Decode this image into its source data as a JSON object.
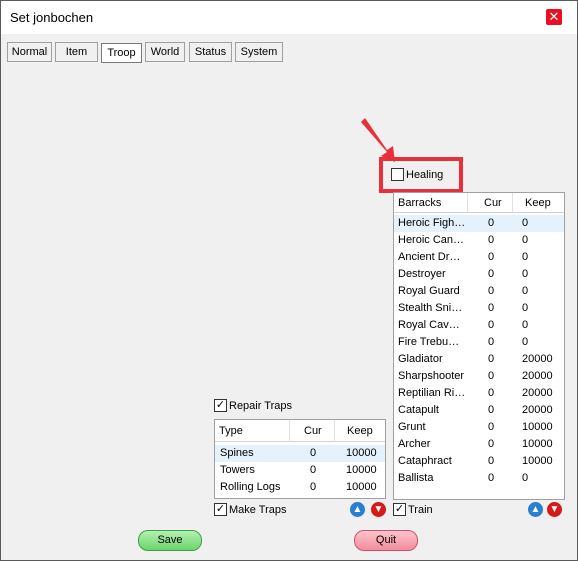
{
  "window": {
    "title": "Set jonbochen"
  },
  "tabs": [
    "Normal",
    "Item",
    "Troop",
    "World",
    "Status",
    "System"
  ],
  "active_tab": "Troop",
  "healing": {
    "label": "Healing",
    "checked": false
  },
  "barracks": {
    "headers": [
      "Barracks",
      "Cur",
      "Keep"
    ],
    "rows": [
      [
        "Heroic Figh…",
        "0",
        "0"
      ],
      [
        "Heroic Can…",
        "0",
        "0"
      ],
      [
        "Ancient Dr…",
        "0",
        "0"
      ],
      [
        "Destroyer",
        "0",
        "0"
      ],
      [
        "Royal Guard",
        "0",
        "0"
      ],
      [
        "Stealth Sni…",
        "0",
        "0"
      ],
      [
        "Royal Cav…",
        "0",
        "0"
      ],
      [
        "Fire Trebu…",
        "0",
        "0"
      ],
      [
        "Gladiator",
        "0",
        "20000"
      ],
      [
        "Sharpshooter",
        "0",
        "20000"
      ],
      [
        "Reptilian Ri…",
        "0",
        "20000"
      ],
      [
        "Catapult",
        "0",
        "20000"
      ],
      [
        "Grunt",
        "0",
        "10000"
      ],
      [
        "Archer",
        "0",
        "10000"
      ],
      [
        "Cataphract",
        "0",
        "10000"
      ],
      [
        "Ballista",
        "0",
        "0"
      ]
    ]
  },
  "train": {
    "label": "Train",
    "checked": true
  },
  "repair_traps": {
    "label": "Repair Traps",
    "checked": true
  },
  "traps": {
    "headers": [
      "Type",
      "Cur",
      "Keep"
    ],
    "rows": [
      [
        "Spines",
        "0",
        "10000"
      ],
      [
        "Towers",
        "0",
        "10000"
      ],
      [
        "Rolling Logs",
        "0",
        "10000"
      ]
    ]
  },
  "make_traps": {
    "label": "Make Traps",
    "checked": true
  },
  "buttons": {
    "save": "Save",
    "quit": "Quit"
  },
  "colors": {
    "highlight": "#e8303a",
    "up_arrow": "#2a7fd0",
    "down_arrow": "#d61a1a",
    "save": "#6cd46c",
    "quit": "#f28c9c"
  },
  "icons": {
    "close": "close-icon",
    "up": "arrow-up-icon",
    "down": "arrow-down-icon"
  }
}
